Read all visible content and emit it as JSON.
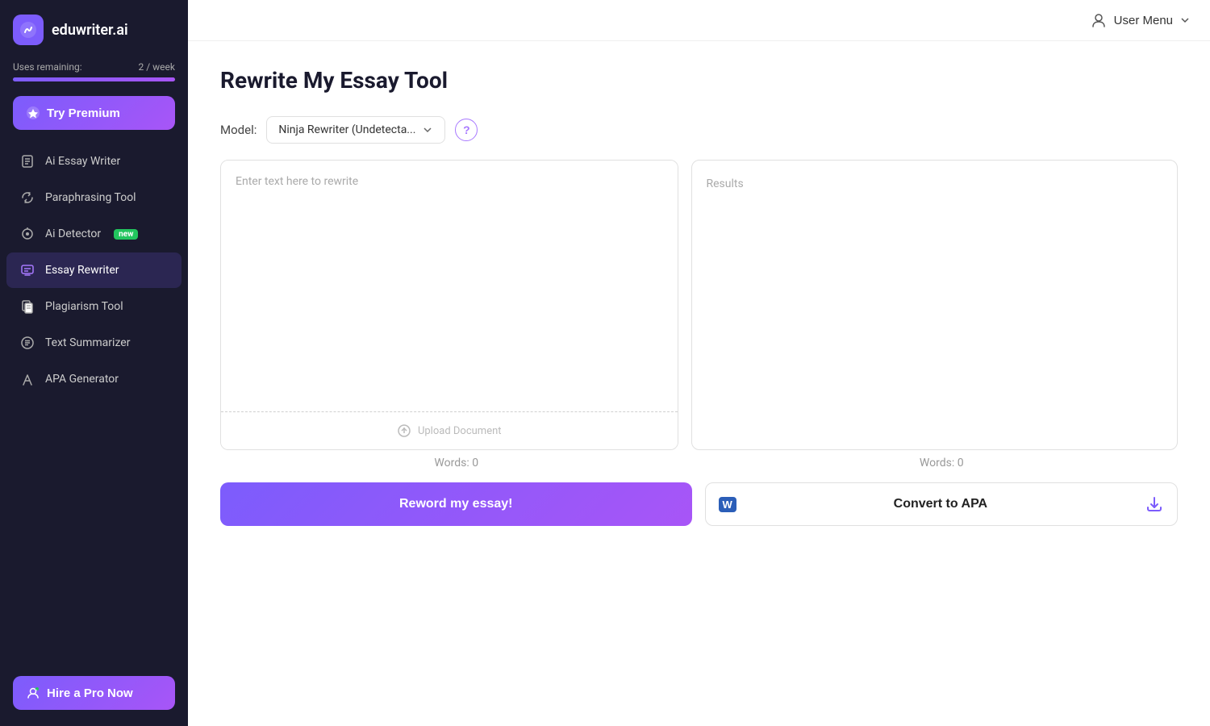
{
  "sidebar": {
    "logo_text": "eduwriter.ai",
    "usage": {
      "label": "Uses remaining:",
      "value": "2 / week",
      "fill_percent": 100
    },
    "try_premium_label": "Try Premium",
    "hire_pro_label": "Hire a Pro Now",
    "nav_items": [
      {
        "id": "ai-essay-writer",
        "label": "Ai Essay Writer",
        "icon": "essay"
      },
      {
        "id": "paraphrasing-tool",
        "label": "Paraphrasing Tool",
        "icon": "paraphrase"
      },
      {
        "id": "ai-detector",
        "label": "Ai Detector",
        "icon": "detector",
        "badge": "new"
      },
      {
        "id": "essay-rewriter",
        "label": "Essay Rewriter",
        "icon": "rewriter",
        "active": true
      },
      {
        "id": "plagiarism-tool",
        "label": "Plagiarism Tool",
        "icon": "plagiarism"
      },
      {
        "id": "text-summarizer",
        "label": "Text Summarizer",
        "icon": "summarizer"
      },
      {
        "id": "apa-generator",
        "label": "APA Generator",
        "icon": "apa"
      }
    ]
  },
  "header": {
    "user_menu_label": "User Menu"
  },
  "main": {
    "page_title": "Rewrite My Essay Tool",
    "model_label": "Model:",
    "model_selected": "Ninja Rewriter (Undetecta...",
    "help_tooltip": "?",
    "input_placeholder": "Enter text here to rewrite",
    "results_label": "Results",
    "upload_label": "Upload Document",
    "words_left": "Words: 0",
    "words_right": "Words: 0",
    "reword_btn": "Reword my essay!",
    "convert_apa_btn": "Convert to APA",
    "word_icon_label": "W"
  }
}
